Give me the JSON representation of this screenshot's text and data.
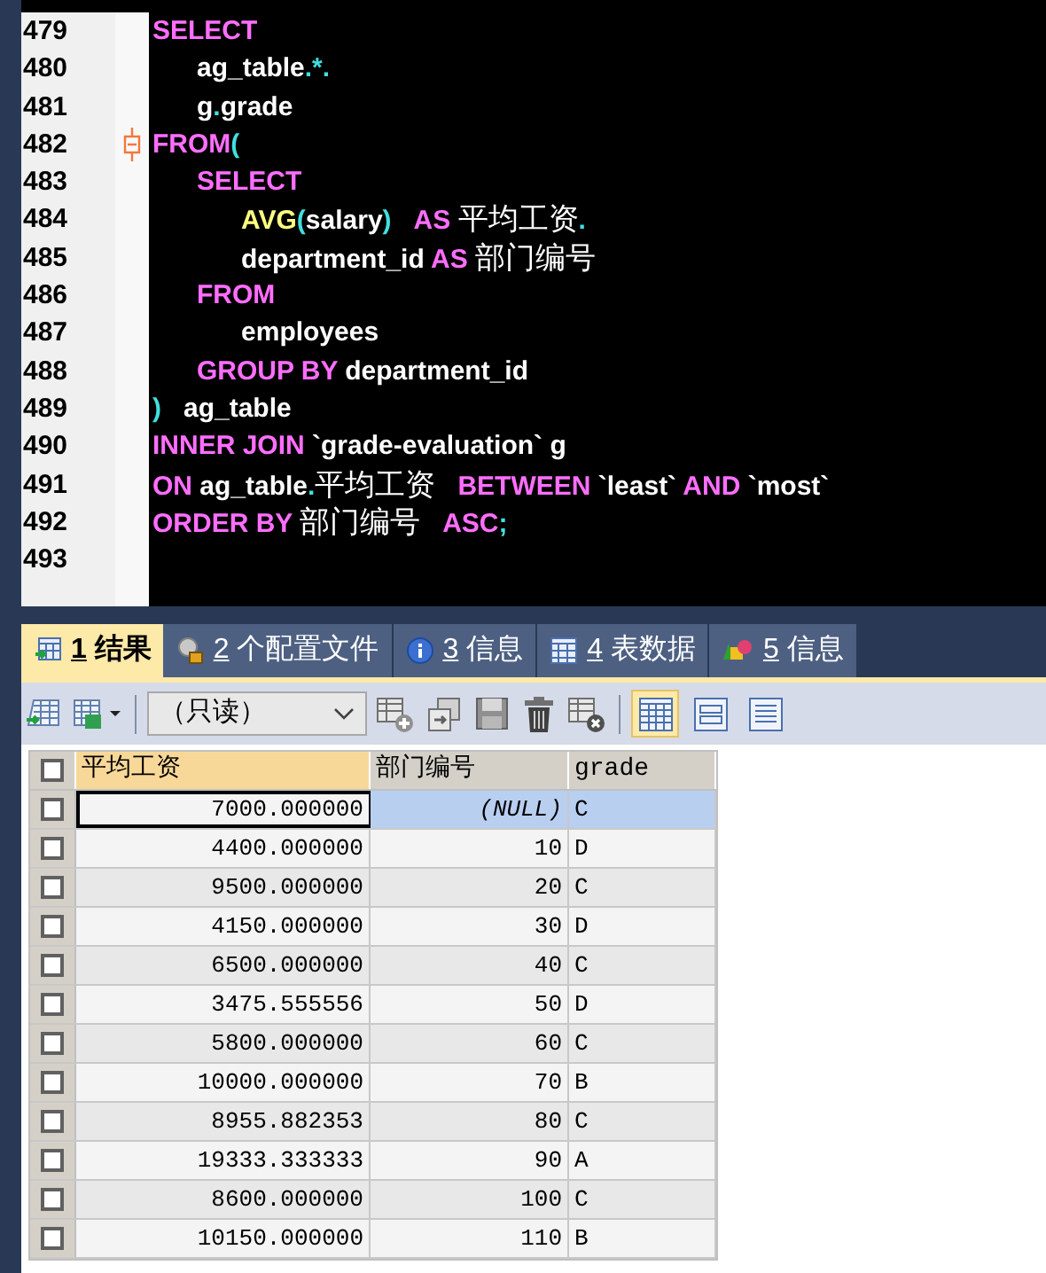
{
  "editor": {
    "lines": [
      {
        "number": "479",
        "fold": false,
        "tokens": [
          {
            "kind": "keyword",
            "text": "SELECT"
          }
        ]
      },
      {
        "number": "480",
        "fold": false,
        "tokens": [
          {
            "kind": "ident",
            "text": "  ag_table"
          },
          {
            "kind": "punct",
            "text": ".*."
          }
        ]
      },
      {
        "number": "481",
        "fold": false,
        "tokens": [
          {
            "kind": "ident",
            "text": "  g"
          },
          {
            "kind": "punct",
            "text": "."
          },
          {
            "kind": "ident",
            "text": "grade"
          }
        ]
      },
      {
        "number": "482",
        "fold": true,
        "tokens": [
          {
            "kind": "keyword",
            "text": "FROM"
          },
          {
            "kind": "punct",
            "text": "("
          }
        ]
      },
      {
        "number": "483",
        "fold": false,
        "tokens": [
          {
            "kind": "keyword",
            "text": "  SELECT"
          }
        ]
      },
      {
        "number": "484",
        "fold": false,
        "tokens": [
          {
            "kind": "func",
            "text": "    AVG"
          },
          {
            "kind": "punct",
            "text": "("
          },
          {
            "kind": "ident",
            "text": "salary"
          },
          {
            "kind": "punct",
            "text": ")"
          },
          {
            "kind": "keyword",
            "text": " AS "
          },
          {
            "kind": "cjk",
            "text": "平均工资"
          },
          {
            "kind": "punct",
            "text": "."
          }
        ]
      },
      {
        "number": "485",
        "fold": false,
        "tokens": [
          {
            "kind": "ident",
            "text": "    department_id "
          },
          {
            "kind": "keyword",
            "text": "AS "
          },
          {
            "kind": "cjk",
            "text": "部门编号"
          }
        ]
      },
      {
        "number": "486",
        "fold": false,
        "tokens": [
          {
            "kind": "keyword",
            "text": "  FROM"
          }
        ]
      },
      {
        "number": "487",
        "fold": false,
        "tokens": [
          {
            "kind": "ident",
            "text": "    employees"
          }
        ]
      },
      {
        "number": "488",
        "fold": false,
        "tokens": [
          {
            "kind": "keyword",
            "text": "  GROUP BY "
          },
          {
            "kind": "ident",
            "text": "department_id"
          }
        ]
      },
      {
        "number": "489",
        "fold": false,
        "tokens": [
          {
            "kind": "punct",
            "text": ")"
          },
          {
            "kind": "ident",
            "text": " ag_table"
          }
        ]
      },
      {
        "number": "490",
        "fold": false,
        "tokens": [
          {
            "kind": "keyword",
            "text": "INNER JOIN "
          },
          {
            "kind": "ident",
            "text": "`grade-evaluation` g"
          }
        ]
      },
      {
        "number": "491",
        "fold": false,
        "tokens": [
          {
            "kind": "keyword",
            "text": "ON "
          },
          {
            "kind": "ident",
            "text": "ag_table"
          },
          {
            "kind": "punct",
            "text": "."
          },
          {
            "kind": "cjk",
            "text": "平均工资"
          },
          {
            "kind": "keyword",
            "text": " BETWEEN "
          },
          {
            "kind": "ident",
            "text": "`least` "
          },
          {
            "kind": "keyword",
            "text": "AND "
          },
          {
            "kind": "ident",
            "text": "`most`"
          }
        ]
      },
      {
        "number": "492",
        "fold": false,
        "tokens": [
          {
            "kind": "keyword",
            "text": "ORDER BY "
          },
          {
            "kind": "cjk",
            "text": "部门编号"
          },
          {
            "kind": "keyword",
            "text": " ASC"
          },
          {
            "kind": "punct",
            "text": ";"
          }
        ]
      },
      {
        "number": "493",
        "fold": false
      }
    ]
  },
  "tabs": [
    {
      "kind": "results",
      "number": "1",
      "label": "结果",
      "selected": true
    },
    {
      "kind": "profile",
      "number": "2",
      "label": "个配置文件",
      "selected": false
    },
    {
      "kind": "info",
      "number": "3",
      "label": "信息",
      "selected": false
    },
    {
      "kind": "table",
      "number": "4",
      "label": "表数据",
      "selected": false
    },
    {
      "kind": "shapes",
      "number": "5",
      "label": "信息",
      "selected": false
    }
  ],
  "toolbar": {
    "mode": "（只读）",
    "views": [
      {
        "kind": "grid",
        "selected": true
      },
      {
        "kind": "form",
        "selected": false
      },
      {
        "kind": "text",
        "selected": false
      }
    ]
  },
  "grid": {
    "all_checked": false,
    "columns": [
      {
        "label": "平均工资",
        "selected": true
      },
      {
        "label": "部门编号",
        "selected": false
      },
      {
        "label": "grade",
        "selected": false
      }
    ],
    "rows": [
      {
        "checked": false,
        "selected": true,
        "cells": [
          "7000.000000",
          "(NULL)",
          "C"
        ]
      },
      {
        "checked": false,
        "selected": false,
        "cells": [
          "4400.000000",
          "10",
          "D"
        ]
      },
      {
        "checked": false,
        "selected": false,
        "cells": [
          "9500.000000",
          "20",
          "C"
        ]
      },
      {
        "checked": false,
        "selected": false,
        "cells": [
          "4150.000000",
          "30",
          "D"
        ]
      },
      {
        "checked": false,
        "selected": false,
        "cells": [
          "6500.000000",
          "40",
          "C"
        ]
      },
      {
        "checked": false,
        "selected": false,
        "cells": [
          "3475.555556",
          "50",
          "D"
        ]
      },
      {
        "checked": false,
        "selected": false,
        "cells": [
          "5800.000000",
          "60",
          "C"
        ]
      },
      {
        "checked": false,
        "selected": false,
        "cells": [
          "10000.000000",
          "70",
          "B"
        ]
      },
      {
        "checked": false,
        "selected": false,
        "cells": [
          "8955.882353",
          "80",
          "C"
        ]
      },
      {
        "checked": false,
        "selected": false,
        "cells": [
          "19333.333333",
          "90",
          "A"
        ]
      },
      {
        "checked": false,
        "selected": false,
        "cells": [
          "8600.000000",
          "100",
          "C"
        ]
      },
      {
        "checked": false,
        "selected": false,
        "cells": [
          "10150.000000",
          "110",
          "B"
        ]
      }
    ]
  }
}
